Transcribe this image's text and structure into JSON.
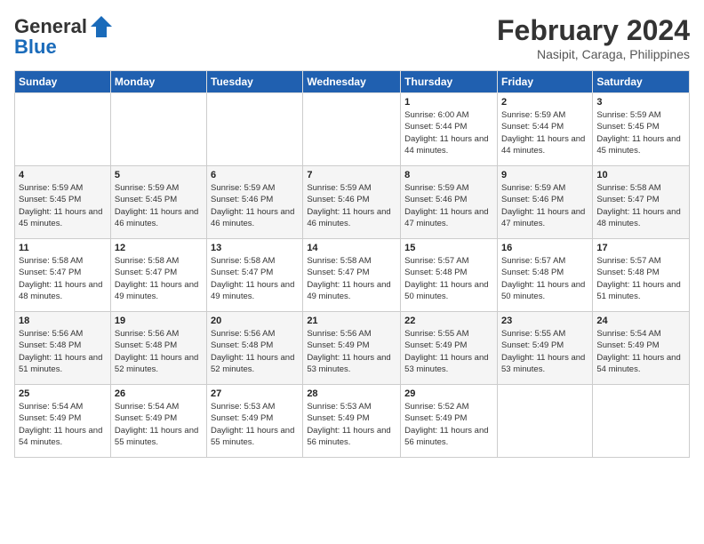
{
  "header": {
    "logo_line1": "General",
    "logo_line2": "Blue",
    "title": "February 2024",
    "location": "Nasipit, Caraga, Philippines"
  },
  "weekdays": [
    "Sunday",
    "Monday",
    "Tuesday",
    "Wednesday",
    "Thursday",
    "Friday",
    "Saturday"
  ],
  "weeks": [
    [
      {
        "day": "",
        "sunrise": "",
        "sunset": "",
        "daylight": ""
      },
      {
        "day": "",
        "sunrise": "",
        "sunset": "",
        "daylight": ""
      },
      {
        "day": "",
        "sunrise": "",
        "sunset": "",
        "daylight": ""
      },
      {
        "day": "",
        "sunrise": "",
        "sunset": "",
        "daylight": ""
      },
      {
        "day": "1",
        "sunrise": "Sunrise: 6:00 AM",
        "sunset": "Sunset: 5:44 PM",
        "daylight": "Daylight: 11 hours and 44 minutes."
      },
      {
        "day": "2",
        "sunrise": "Sunrise: 5:59 AM",
        "sunset": "Sunset: 5:44 PM",
        "daylight": "Daylight: 11 hours and 44 minutes."
      },
      {
        "day": "3",
        "sunrise": "Sunrise: 5:59 AM",
        "sunset": "Sunset: 5:45 PM",
        "daylight": "Daylight: 11 hours and 45 minutes."
      }
    ],
    [
      {
        "day": "4",
        "sunrise": "Sunrise: 5:59 AM",
        "sunset": "Sunset: 5:45 PM",
        "daylight": "Daylight: 11 hours and 45 minutes."
      },
      {
        "day": "5",
        "sunrise": "Sunrise: 5:59 AM",
        "sunset": "Sunset: 5:45 PM",
        "daylight": "Daylight: 11 hours and 46 minutes."
      },
      {
        "day": "6",
        "sunrise": "Sunrise: 5:59 AM",
        "sunset": "Sunset: 5:46 PM",
        "daylight": "Daylight: 11 hours and 46 minutes."
      },
      {
        "day": "7",
        "sunrise": "Sunrise: 5:59 AM",
        "sunset": "Sunset: 5:46 PM",
        "daylight": "Daylight: 11 hours and 46 minutes."
      },
      {
        "day": "8",
        "sunrise": "Sunrise: 5:59 AM",
        "sunset": "Sunset: 5:46 PM",
        "daylight": "Daylight: 11 hours and 47 minutes."
      },
      {
        "day": "9",
        "sunrise": "Sunrise: 5:59 AM",
        "sunset": "Sunset: 5:46 PM",
        "daylight": "Daylight: 11 hours and 47 minutes."
      },
      {
        "day": "10",
        "sunrise": "Sunrise: 5:58 AM",
        "sunset": "Sunset: 5:47 PM",
        "daylight": "Daylight: 11 hours and 48 minutes."
      }
    ],
    [
      {
        "day": "11",
        "sunrise": "Sunrise: 5:58 AM",
        "sunset": "Sunset: 5:47 PM",
        "daylight": "Daylight: 11 hours and 48 minutes."
      },
      {
        "day": "12",
        "sunrise": "Sunrise: 5:58 AM",
        "sunset": "Sunset: 5:47 PM",
        "daylight": "Daylight: 11 hours and 49 minutes."
      },
      {
        "day": "13",
        "sunrise": "Sunrise: 5:58 AM",
        "sunset": "Sunset: 5:47 PM",
        "daylight": "Daylight: 11 hours and 49 minutes."
      },
      {
        "day": "14",
        "sunrise": "Sunrise: 5:58 AM",
        "sunset": "Sunset: 5:47 PM",
        "daylight": "Daylight: 11 hours and 49 minutes."
      },
      {
        "day": "15",
        "sunrise": "Sunrise: 5:57 AM",
        "sunset": "Sunset: 5:48 PM",
        "daylight": "Daylight: 11 hours and 50 minutes."
      },
      {
        "day": "16",
        "sunrise": "Sunrise: 5:57 AM",
        "sunset": "Sunset: 5:48 PM",
        "daylight": "Daylight: 11 hours and 50 minutes."
      },
      {
        "day": "17",
        "sunrise": "Sunrise: 5:57 AM",
        "sunset": "Sunset: 5:48 PM",
        "daylight": "Daylight: 11 hours and 51 minutes."
      }
    ],
    [
      {
        "day": "18",
        "sunrise": "Sunrise: 5:56 AM",
        "sunset": "Sunset: 5:48 PM",
        "daylight": "Daylight: 11 hours and 51 minutes."
      },
      {
        "day": "19",
        "sunrise": "Sunrise: 5:56 AM",
        "sunset": "Sunset: 5:48 PM",
        "daylight": "Daylight: 11 hours and 52 minutes."
      },
      {
        "day": "20",
        "sunrise": "Sunrise: 5:56 AM",
        "sunset": "Sunset: 5:48 PM",
        "daylight": "Daylight: 11 hours and 52 minutes."
      },
      {
        "day": "21",
        "sunrise": "Sunrise: 5:56 AM",
        "sunset": "Sunset: 5:49 PM",
        "daylight": "Daylight: 11 hours and 53 minutes."
      },
      {
        "day": "22",
        "sunrise": "Sunrise: 5:55 AM",
        "sunset": "Sunset: 5:49 PM",
        "daylight": "Daylight: 11 hours and 53 minutes."
      },
      {
        "day": "23",
        "sunrise": "Sunrise: 5:55 AM",
        "sunset": "Sunset: 5:49 PM",
        "daylight": "Daylight: 11 hours and 53 minutes."
      },
      {
        "day": "24",
        "sunrise": "Sunrise: 5:54 AM",
        "sunset": "Sunset: 5:49 PM",
        "daylight": "Daylight: 11 hours and 54 minutes."
      }
    ],
    [
      {
        "day": "25",
        "sunrise": "Sunrise: 5:54 AM",
        "sunset": "Sunset: 5:49 PM",
        "daylight": "Daylight: 11 hours and 54 minutes."
      },
      {
        "day": "26",
        "sunrise": "Sunrise: 5:54 AM",
        "sunset": "Sunset: 5:49 PM",
        "daylight": "Daylight: 11 hours and 55 minutes."
      },
      {
        "day": "27",
        "sunrise": "Sunrise: 5:53 AM",
        "sunset": "Sunset: 5:49 PM",
        "daylight": "Daylight: 11 hours and 55 minutes."
      },
      {
        "day": "28",
        "sunrise": "Sunrise: 5:53 AM",
        "sunset": "Sunset: 5:49 PM",
        "daylight": "Daylight: 11 hours and 56 minutes."
      },
      {
        "day": "29",
        "sunrise": "Sunrise: 5:52 AM",
        "sunset": "Sunset: 5:49 PM",
        "daylight": "Daylight: 11 hours and 56 minutes."
      },
      {
        "day": "",
        "sunrise": "",
        "sunset": "",
        "daylight": ""
      },
      {
        "day": "",
        "sunrise": "",
        "sunset": "",
        "daylight": ""
      }
    ]
  ]
}
